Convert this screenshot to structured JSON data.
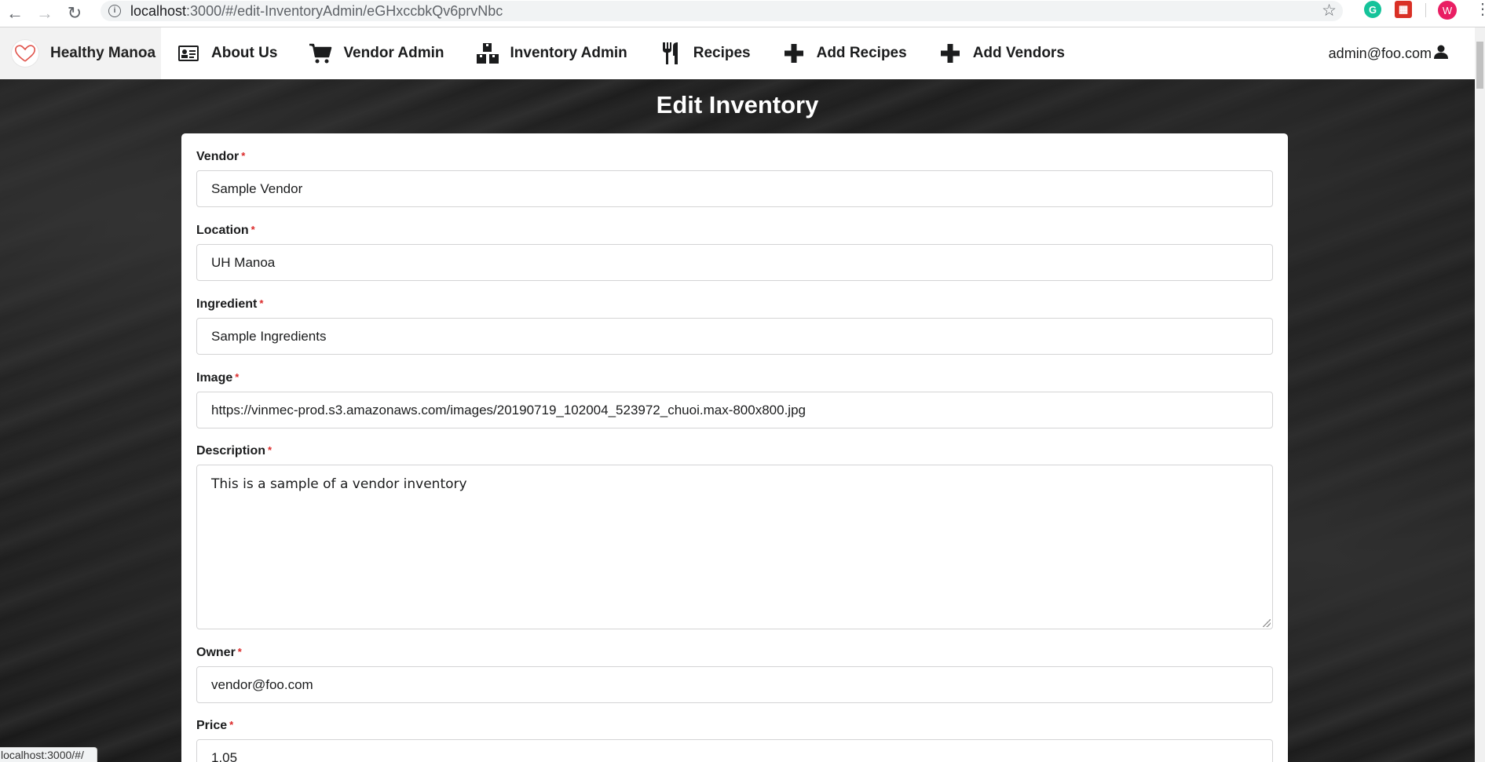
{
  "browser": {
    "url_host": "localhost",
    "url_path": ":3000/#/edit-InventoryAdmin/eGHxccbkQv6prvNbc",
    "profile_initial": "W",
    "status_tip": "localhost:3000/#/"
  },
  "navbar": {
    "brand": "Healthy Manoa",
    "items": [
      {
        "label": "About Us",
        "icon": "id-card-icon"
      },
      {
        "label": "Vendor Admin",
        "icon": "cart-icon"
      },
      {
        "label": "Inventory Admin",
        "icon": "boxes-icon"
      },
      {
        "label": "Recipes",
        "icon": "utensils-icon"
      },
      {
        "label": "Add Recipes",
        "icon": "plus-icon"
      },
      {
        "label": "Add Vendors",
        "icon": "plus-icon"
      }
    ],
    "user": "admin@foo.com"
  },
  "page": {
    "title": "Edit Inventory"
  },
  "form": {
    "vendor": {
      "label": "Vendor",
      "value": "Sample Vendor"
    },
    "location": {
      "label": "Location",
      "value": "UH Manoa"
    },
    "ingredient": {
      "label": "Ingredient",
      "value": "Sample Ingredients"
    },
    "image": {
      "label": "Image",
      "value": "https://vinmec-prod.s3.amazonaws.com/images/20190719_102004_523972_chuoi.max-800x800.jpg"
    },
    "description": {
      "label": "Description",
      "value": "This is a sample of a vendor inventory"
    },
    "owner": {
      "label": "Owner",
      "value": "vendor@foo.com"
    },
    "price": {
      "label": "Price",
      "value": "1.05"
    },
    "required_mark": "*"
  },
  "colors": {
    "required": "#db2828",
    "navbar_bg": "#ffffff",
    "brand_bg": "#f2f2f2"
  }
}
